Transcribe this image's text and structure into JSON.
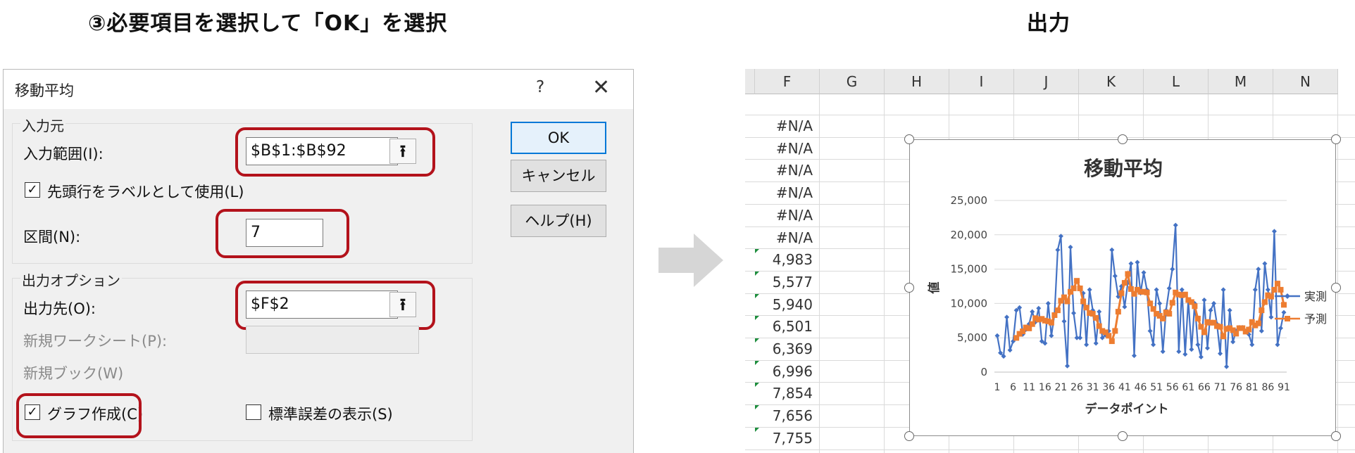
{
  "headings": {
    "step": "③必要項目を選択して「OK」を選択",
    "output": "出力"
  },
  "dialog": {
    "title": "移動平均",
    "help_icon_label": "?",
    "close_icon_label": "✕",
    "input_group_label": "入力元",
    "input_range_label": "入力範囲(I):",
    "input_range_value": "$B$1:$B$92",
    "labels_first_row_label": "先頭行をラベルとして使用(L)",
    "labels_first_row_checked": true,
    "interval_label": "区間(N):",
    "interval_value": "7",
    "output_group_label": "出力オプション",
    "output_range_label": "出力先(O):",
    "output_range_value": "$F$2",
    "new_sheet_label": "新規ワークシート(P):",
    "new_book_label": "新規ブック(W)",
    "chart_output_label": "グラフ作成(C)",
    "chart_output_checked": true,
    "std_error_label": "標準誤差の表示(S)",
    "std_error_checked": false,
    "ok_label": "OK",
    "cancel_label": "キャンセル",
    "help_label": "ヘルプ(H)",
    "ref_icon": "collapse-dialog-icon"
  },
  "sheet": {
    "columns": [
      "F",
      "G",
      "H",
      "I",
      "J",
      "K",
      "L",
      "M",
      "N"
    ],
    "f_values": [
      "#N/A",
      "#N/A",
      "#N/A",
      "#N/A",
      "#N/A",
      "#N/A",
      "4,983",
      "5,577",
      "5,940",
      "6,501",
      "6,369",
      "6,996",
      "7,854",
      "7,656",
      "7,755"
    ]
  },
  "colors": {
    "highlight": "#b3121b",
    "actual": "#4472c4",
    "forecast": "#ed7d31"
  },
  "chart_data": {
    "type": "line",
    "title": "移動平均",
    "xlabel": "データポイント",
    "ylabel": "値",
    "ylim": [
      0,
      25000
    ],
    "yticks": [
      "0",
      "5,000",
      "10,000",
      "15,000",
      "20,000",
      "25,000"
    ],
    "xticks": [
      "1",
      "6",
      "11",
      "16",
      "21",
      "26",
      "31",
      "36",
      "41",
      "46",
      "51",
      "56",
      "61",
      "66",
      "71",
      "76",
      "81",
      "86",
      "91"
    ],
    "legend_position": "right",
    "series": [
      {
        "name": "実測",
        "values": [
          5300,
          2800,
          2300,
          8000,
          3200,
          4500,
          9000,
          9400,
          5500,
          6200,
          7000,
          8800,
          7300,
          9300,
          4500,
          4200,
          10000,
          5300,
          8500,
          17800,
          19800,
          7400,
          900,
          18200,
          8600,
          5000,
          5000,
          11500,
          4000,
          12000,
          9000,
          4200,
          8800,
          5000,
          5400,
          6000,
          17800,
          14000,
          11000,
          12500,
          9500,
          13000,
          15800,
          2400,
          16000,
          11500,
          14500,
          12000,
          6000,
          4000,
          12000,
          10000,
          3000,
          9000,
          12200,
          15000,
          21400,
          3000,
          12000,
          2600,
          10500,
          3300,
          10000,
          4000,
          2200,
          10500,
          3500,
          9000,
          10000,
          7000,
          2700,
          12000,
          800,
          9000,
          4400,
          6000,
          6500,
          6500,
          6000,
          5500,
          4000,
          12000,
          15000,
          6000,
          15800,
          12000,
          8000,
          20500,
          4000,
          6400,
          8700
        ]
      },
      {
        "name": "予測",
        "values": [
          null,
          null,
          null,
          null,
          null,
          null,
          4983,
          5577,
          5940,
          6501,
          6369,
          6996,
          7854,
          7656,
          7755,
          7500,
          7400,
          7200,
          8300,
          9000,
          10400,
          10900,
          10300,
          11700,
          12200,
          13300,
          12200,
          10300,
          9400,
          8600,
          8500,
          7900,
          6700,
          6000,
          5800,
          5300,
          4500,
          6000,
          8800,
          11500,
          13000,
          14300,
          12100,
          11400,
          12000,
          11700,
          11700,
          11600,
          10000,
          9200,
          8500,
          8200,
          7800,
          8700,
          8500,
          10100,
          11600,
          11300,
          11200,
          11300,
          10500,
          10200,
          9600,
          7800,
          6600,
          5800,
          7300,
          7200,
          7200,
          6700,
          6600,
          5200,
          6300,
          6400,
          6100,
          5600,
          6400,
          6400,
          5900,
          6200,
          7300,
          6800,
          7100,
          9000,
          10200,
          11200,
          11000,
          12000,
          12900,
          12000,
          9800
        ]
      }
    ]
  }
}
